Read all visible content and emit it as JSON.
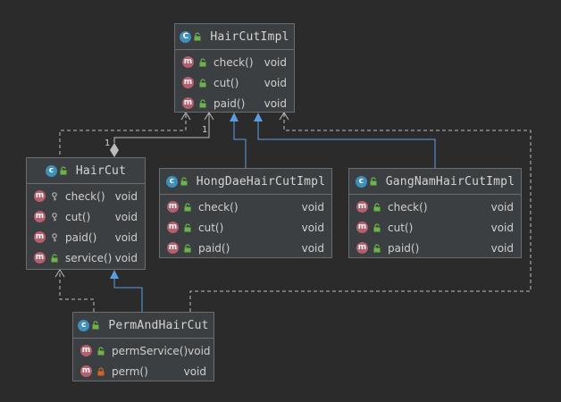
{
  "classes": {
    "hair_cut_impl": {
      "name": "HairCutImpl",
      "badge": "C",
      "kind": "interface",
      "members": [
        {
          "badge": "m",
          "visibility": "public",
          "name": "check()",
          "type": "void"
        },
        {
          "badge": "m",
          "visibility": "public",
          "name": "cut()",
          "type": "void"
        },
        {
          "badge": "m",
          "visibility": "public",
          "name": "paid()",
          "type": "void"
        }
      ]
    },
    "hair_cut": {
      "name": "HairCut",
      "badge": "c",
      "kind": "class",
      "members": [
        {
          "badge": "m",
          "visibility": "package",
          "name": "check()",
          "type": "void"
        },
        {
          "badge": "m",
          "visibility": "package",
          "name": "cut()",
          "type": "void"
        },
        {
          "badge": "m",
          "visibility": "package",
          "name": "paid()",
          "type": "void"
        },
        {
          "badge": "m",
          "visibility": "public",
          "name": "service()",
          "type": "void"
        }
      ]
    },
    "hong_dae": {
      "name": "HongDaeHairCutImpl",
      "badge": "c",
      "kind": "class",
      "members": [
        {
          "badge": "m",
          "visibility": "public",
          "name": "check()",
          "type": "void"
        },
        {
          "badge": "m",
          "visibility": "public",
          "name": "cut()",
          "type": "void"
        },
        {
          "badge": "m",
          "visibility": "public",
          "name": "paid()",
          "type": "void"
        }
      ]
    },
    "gang_nam": {
      "name": "GangNamHairCutImpl",
      "badge": "c",
      "kind": "class",
      "members": [
        {
          "badge": "m",
          "visibility": "public",
          "name": "check()",
          "type": "void"
        },
        {
          "badge": "m",
          "visibility": "public",
          "name": "cut()",
          "type": "void"
        },
        {
          "badge": "m",
          "visibility": "public",
          "name": "paid()",
          "type": "void"
        }
      ]
    },
    "perm_and_hair_cut": {
      "name": "PermAndHairCut",
      "badge": "c",
      "kind": "class",
      "members": [
        {
          "badge": "m",
          "visibility": "public",
          "name": "permService()",
          "type": "void"
        },
        {
          "badge": "m",
          "visibility": "private",
          "name": "perm()",
          "type": "void"
        }
      ]
    }
  },
  "relations": {
    "multiplicity_impl_end": "1",
    "multiplicity_haircut_end": "1"
  },
  "colors": {
    "background": "#2b2b2b",
    "box": "#3c3f41",
    "border": "#6a6d70",
    "dependency_line": "#bcbcbc",
    "inheritance_line": "#5c9be0",
    "public_icon": "#6cb34a",
    "package_icon": "#b0b0b0",
    "private_icon": "#d0652a"
  }
}
